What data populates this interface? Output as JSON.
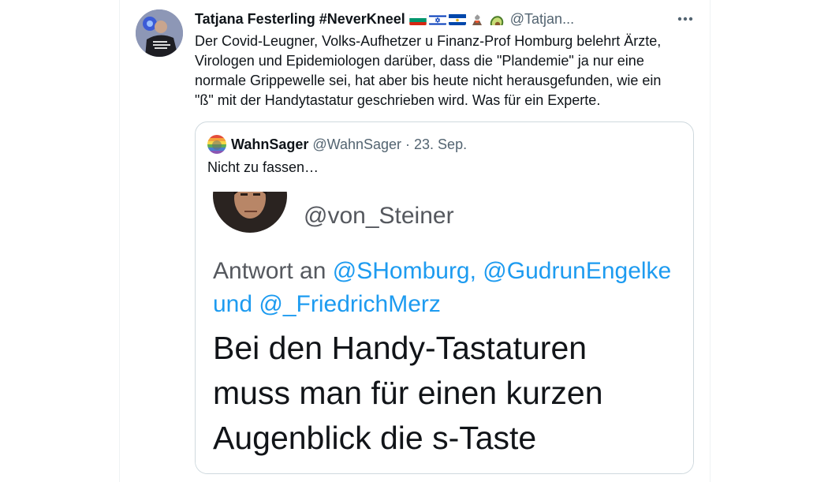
{
  "tweet": {
    "author_name": "Tatjana Festerling #NeverKneel",
    "handle": "@Tatjan...",
    "text": "Der Covid-Leugner, Volks-Aufhetzer u Finanz-Prof Homburg belehrt Ärzte,\nVirologen und Epidemiologen darüber, dass die \"Plandemie\" ja nur eine\nnormale Grippewelle sei, hat aber bis heute nicht herausgefunden, wie ein\n\"ß\" mit der Handytastatur geschrieben wird. Was für ein Experte.",
    "flags": [
      "bulgaria-flag-icon",
      "israel-flag-icon",
      "el-salvador-flag-icon",
      "volcano-icon",
      "avocado-icon"
    ]
  },
  "quote": {
    "author_name": "WahnSager",
    "handle": "@WahnSager",
    "separator": "·",
    "date": "23. Sep.",
    "text": "Nicht zu fassen…"
  },
  "embedded": {
    "handle": "@von_Steiner",
    "reply_prefix": "Antwort an",
    "mention_1": "@SHomburg,",
    "mention_2": "@GudrunEngelke",
    "reply_and": "und",
    "mention_3": "@_FriedrichMerz",
    "body_line_1": "Bei den Handy-Tastaturen",
    "body_line_2": "muss man für einen kurzen",
    "body_line_3": "Augenblick die s-Taste"
  },
  "colors": {
    "accent": "#1d9bf0",
    "text_primary": "#0f1419",
    "text_secondary": "#536471",
    "border": "#cfd9de"
  }
}
